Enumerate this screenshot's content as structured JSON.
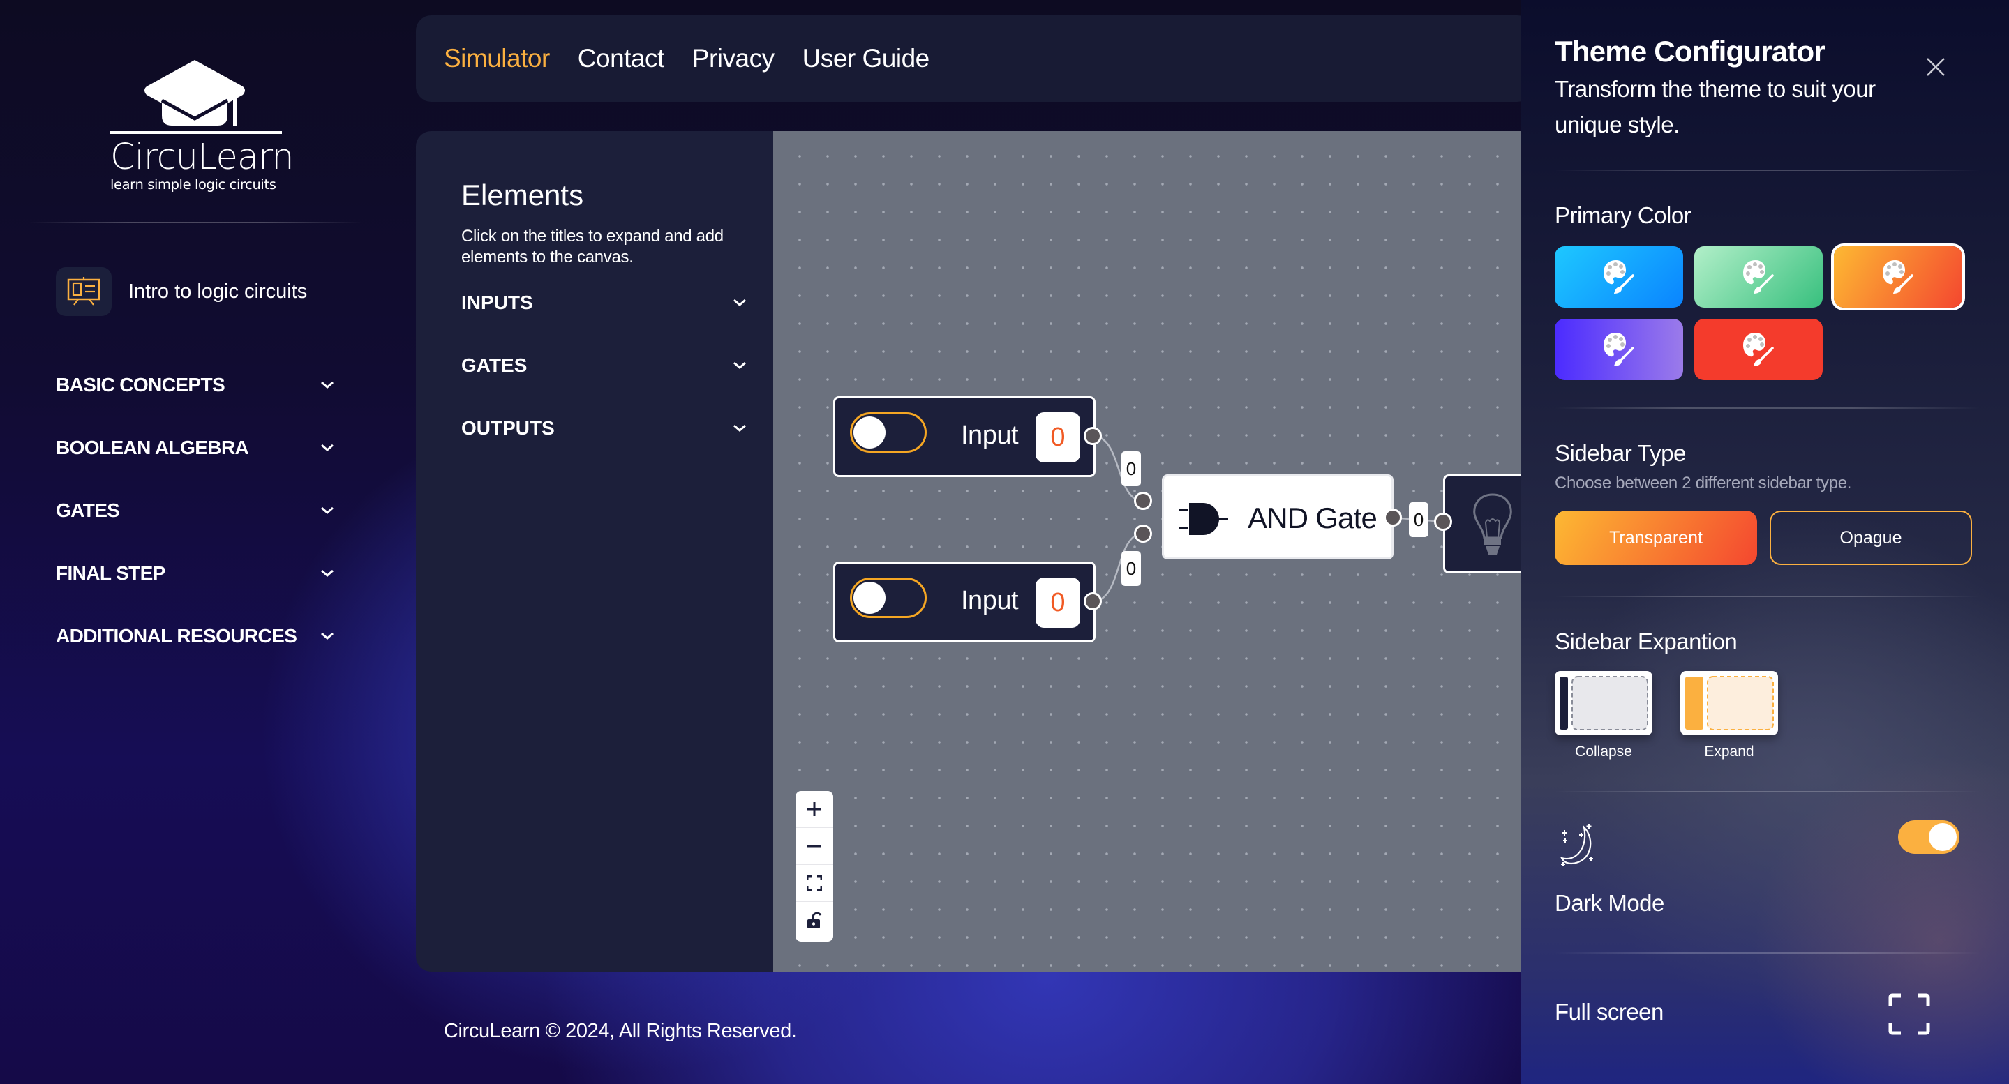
{
  "brand": {
    "name": "CircuLearn",
    "tagline": "learn simple logic circuits",
    "logo_icon": "graduation-cap-icon"
  },
  "sidebar": {
    "intro": {
      "label": "Intro to logic circuits",
      "icon": "presentation-board-icon"
    },
    "items": [
      {
        "label": "BASIC CONCEPTS",
        "expanded": false
      },
      {
        "label": "BOOLEAN ALGEBRA",
        "expanded": false
      },
      {
        "label": "GATES",
        "expanded": false
      },
      {
        "label": "FINAL STEP",
        "expanded": false
      },
      {
        "label": "ADDITIONAL RESOURCES",
        "expanded": false
      }
    ]
  },
  "topnav": {
    "links": [
      {
        "label": "Simulator",
        "active": true
      },
      {
        "label": "Contact",
        "active": false
      },
      {
        "label": "Privacy",
        "active": false
      },
      {
        "label": "User Guide",
        "active": false
      }
    ]
  },
  "elements_panel": {
    "title": "Elements",
    "description": "Click on the titles to expand and add elements to the canvas.",
    "sections": [
      {
        "label": "INPUTS"
      },
      {
        "label": "GATES"
      },
      {
        "label": "OUTPUTS"
      }
    ]
  },
  "canvas": {
    "nodes": [
      {
        "type": "input",
        "label": "Input",
        "value": "0",
        "toggle_on": false
      },
      {
        "type": "input",
        "label": "Input",
        "value": "0",
        "toggle_on": false
      },
      {
        "type": "gate",
        "label": "AND Gate",
        "icon": "and-gate-icon"
      },
      {
        "type": "output",
        "icon": "lightbulb-icon",
        "lit": false
      }
    ],
    "edges": [
      {
        "from": "Input 1",
        "to": "AND Gate",
        "value": "0"
      },
      {
        "from": "Input 2",
        "to": "AND Gate",
        "value": "0"
      },
      {
        "from": "AND Gate",
        "to": "Bulb",
        "value": "0"
      }
    ],
    "controls": [
      {
        "name": "zoom-in",
        "icon": "plus-icon"
      },
      {
        "name": "zoom-out",
        "icon": "minus-icon"
      },
      {
        "name": "fit-view",
        "icon": "fit-view-icon"
      },
      {
        "name": "lock",
        "icon": "unlock-icon"
      }
    ]
  },
  "footer": {
    "text": "CircuLearn © 2024, All Rights Reserved."
  },
  "theme_configurator": {
    "title": "Theme Configurator",
    "subtitle": "Transform the theme to suit your unique style.",
    "primary_color": {
      "label": "Primary Color",
      "swatches": [
        {
          "name": "blue",
          "from": "#1ec8ff",
          "to": "#0a84ff",
          "selected": false
        },
        {
          "name": "green",
          "from": "#b2efc9",
          "to": "#38c07e",
          "selected": false
        },
        {
          "name": "orange",
          "from": "#fdb933",
          "to": "#f4472f",
          "selected": true
        },
        {
          "name": "purple",
          "from": "#4b2bff",
          "to": "#9b7bea",
          "selected": false
        },
        {
          "name": "red",
          "from": "#f43b2c",
          "to": "#f43b2c",
          "selected": false
        }
      ]
    },
    "sidebar_type": {
      "label": "Sidebar Type",
      "note": "Choose between 2 different sidebar type.",
      "options": [
        {
          "label": "Transparent",
          "selected": true
        },
        {
          "label": "Opague",
          "selected": false
        }
      ]
    },
    "sidebar_expansion": {
      "label": "Sidebar Expantion",
      "options": [
        {
          "label": "Collapse"
        },
        {
          "label": "Expand"
        }
      ]
    },
    "dark_mode": {
      "label": "Dark Mode",
      "enabled": true,
      "icon": "moon-stars-icon"
    },
    "full_screen": {
      "label": "Full screen",
      "icon": "fullscreen-icon"
    }
  },
  "colors": {
    "accent": "#fbb040",
    "accent_gradient_end": "#f4472f",
    "value_red": "#f15a24",
    "panel": "#1c1f3a",
    "canvas": "#6b717e"
  }
}
